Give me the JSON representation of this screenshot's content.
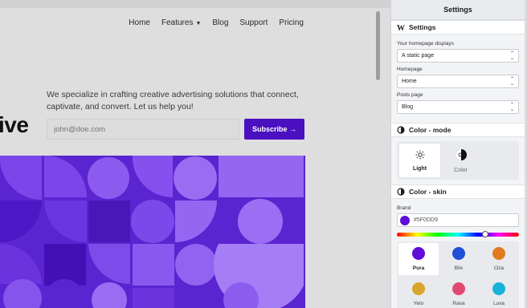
{
  "nav": {
    "items": [
      "Home",
      "Features",
      "Blog",
      "Support",
      "Pricing"
    ]
  },
  "hero": {
    "word_fragment": "ive",
    "tagline": "We specialize in crafting creative advertising solutions that connect, captivate, and convert. Let us help you!",
    "email_placeholder": "john@doe.com",
    "subscribe_label": "Subscribe →"
  },
  "panel": {
    "title": "Settings",
    "settings_section": {
      "title": "Settings",
      "homepage_displays_label": "Your homepage displays",
      "homepage_displays_value": "A static page",
      "homepage_label": "Homepage",
      "homepage_value": "Home",
      "posts_page_label": "Posts page",
      "posts_page_value": "Blog"
    },
    "color_mode": {
      "title": "Color - mode",
      "options": [
        "Light",
        "Color"
      ],
      "selected": "Light"
    },
    "color_skin": {
      "title": "Color - skin",
      "brand_label": "Brand",
      "brand_value": "#5F0DD9",
      "brand_color": "#5f0dd9",
      "skins": [
        {
          "name": "Pura",
          "color": "#5f0dd9"
        },
        {
          "name": "Blix",
          "color": "#1f4fd6"
        },
        {
          "name": "Oza",
          "color": "#e07b1f"
        },
        {
          "name": "Yelo",
          "color": "#d9a52a"
        },
        {
          "name": "Rava",
          "color": "#e04a70"
        },
        {
          "name": "Luva",
          "color": "#19b3d9"
        }
      ],
      "selected": "Pura"
    }
  },
  "colors": {
    "accent": "#4a0fbf",
    "mosaic_purple": "#6a2ee0",
    "mosaic_dark": "#3d0aa8"
  }
}
